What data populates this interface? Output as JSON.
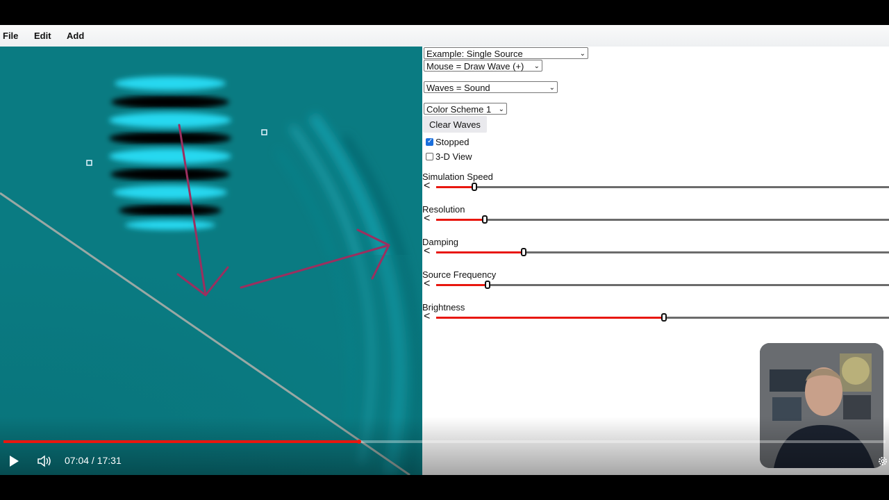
{
  "menu": {
    "file": "File",
    "edit": "Edit",
    "add": "Add"
  },
  "controls": {
    "example_select": "Example: Single Source",
    "mouse_select": "Mouse = Draw Wave (+)",
    "waves_select": "Waves = Sound",
    "color_select": "Color Scheme 1",
    "clear_button": "Clear Waves",
    "stopped_label": "Stopped",
    "stopped_checked": true,
    "view3d_label": "3-D View",
    "view3d_checked": false
  },
  "sliders": [
    {
      "label": "Simulation Speed",
      "value": 0.085
    },
    {
      "label": "Resolution",
      "value": 0.108
    },
    {
      "label": "Damping",
      "value": 0.193
    },
    {
      "label": "Source Frequency",
      "value": 0.114
    },
    {
      "label": "Brightness",
      "value": 0.503
    }
  ],
  "player": {
    "time": "07:04 / 17:31",
    "progress": 0.403
  },
  "icons": {
    "play": "play-icon",
    "volume": "volume-icon",
    "settings": "gear-icon",
    "slider_decrement": "less-than-icon"
  },
  "colors": {
    "canvas_bg": "#0a7b82",
    "wave_bright": "#27d8f0",
    "arrow": "#9b2f5f",
    "slider_fill": "#e8170f",
    "progress": "#e8170f"
  }
}
